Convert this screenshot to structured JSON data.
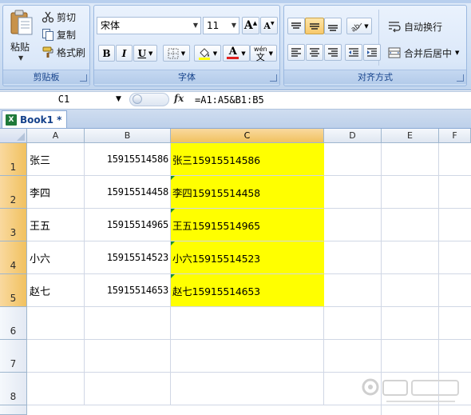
{
  "ribbon": {
    "clipboard": {
      "title": "剪贴板",
      "paste_label": "粘贴",
      "cut_label": "剪切",
      "copy_label": "复制",
      "format_painter_label": "格式刷"
    },
    "font": {
      "title": "字体",
      "font_name": "宋体",
      "font_size": "11",
      "grow_label": "A",
      "shrink_label": "A",
      "bold_label": "B",
      "italic_label": "I",
      "underline_label": "U",
      "font_color_label": "A",
      "phonetic_label": "wén"
    },
    "alignment": {
      "title": "对齐方式",
      "wrap_text_label": "自动换行",
      "merge_center_label": "合并后居中"
    }
  },
  "formula_bar": {
    "name_box": "C1",
    "fx_label": "fx",
    "formula": "=A1:A5&B1:B5"
  },
  "workbook_tab": {
    "label": "Book1 *"
  },
  "grid": {
    "columns": [
      "A",
      "B",
      "C",
      "D",
      "E",
      "F"
    ],
    "selected_column": "C",
    "rows": [
      {
        "num": "1",
        "a": "张三",
        "b": "15915514586",
        "c": "张三15915514586"
      },
      {
        "num": "2",
        "a": "李四",
        "b": "15915514458",
        "c": "李四15915514458"
      },
      {
        "num": "3",
        "a": "王五",
        "b": "15915514965",
        "c": "王五15915514965"
      },
      {
        "num": "4",
        "a": "小六",
        "b": "15915514523",
        "c": "小六15915514523"
      },
      {
        "num": "5",
        "a": "赵七",
        "b": "15915514653",
        "c": "赵七15915514653"
      },
      {
        "num": "6",
        "a": "",
        "b": "",
        "c": ""
      },
      {
        "num": "7",
        "a": "",
        "b": "",
        "c": ""
      },
      {
        "num": "8",
        "a": "",
        "b": "",
        "c": ""
      }
    ]
  },
  "colors": {
    "highlight_fill": "#ffff00",
    "ribbon_title": "#15428b",
    "selected_header": "#f1c15f"
  }
}
